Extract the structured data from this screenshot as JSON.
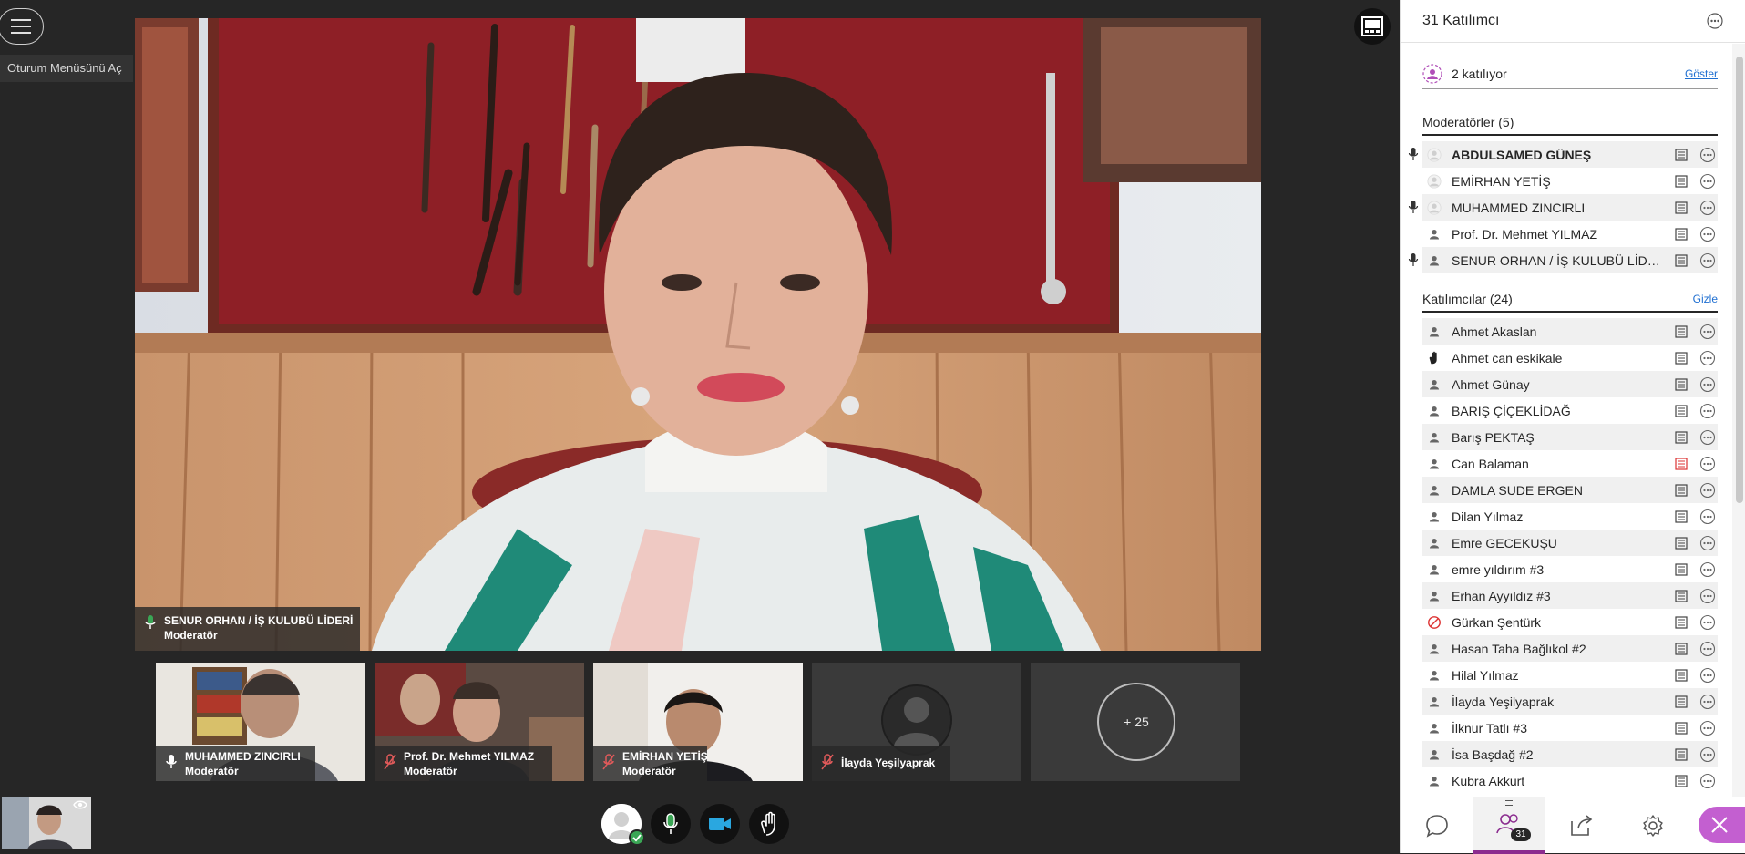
{
  "session_menu": {
    "tooltip": "Oturum Menüsünü Aç"
  },
  "main_video": {
    "name": "SENUR ORHAN / İŞ KULUBÜ LİDERİ",
    "role": "Moderatör"
  },
  "thumbnails": [
    {
      "name": "MUHAMMED ZINCIRLI",
      "role": "Moderatör",
      "mic": "on"
    },
    {
      "name": "Prof. Dr. Mehmet YILMAZ",
      "role": "Moderatör",
      "mic": "muted"
    },
    {
      "name": "EMİRHAN YETİŞ",
      "role": "Moderatör",
      "mic": "muted"
    },
    {
      "name": "İlayda Yeşilyaprak",
      "role": "",
      "mic": "muted"
    }
  ],
  "more_participants": "+ 25",
  "panel": {
    "title": "31 Katılımcı",
    "attending_text": "2 katılıyor",
    "attending_link": "Göster",
    "moderators_heading": "Moderatörler (5)",
    "moderators": [
      {
        "name": "ABDULSAMED GÜNEŞ",
        "mic": true,
        "bold": true
      },
      {
        "name": "EMİRHAN YETİŞ",
        "mic": false,
        "bold": false
      },
      {
        "name": "MUHAMMED ZINCIRLI",
        "mic": true,
        "bold": false
      },
      {
        "name": "Prof. Dr. Mehmet YILMAZ",
        "mic": false,
        "bold": false
      },
      {
        "name": "SENUR ORHAN / İŞ KULUBÜ LİDERİ",
        "mic": true,
        "bold": false
      }
    ],
    "participants_heading": "Katılımcılar (24)",
    "participants_link": "Gizle",
    "participants": [
      {
        "name": "Ahmet Akaslan",
        "avatar": "user"
      },
      {
        "name": "Ahmet can eskikale",
        "avatar": "hand"
      },
      {
        "name": "Ahmet Günay",
        "avatar": "user"
      },
      {
        "name": "BARIŞ ÇİÇEKLİDAĞ",
        "avatar": "user"
      },
      {
        "name": "Barış PEKTAŞ",
        "avatar": "user"
      },
      {
        "name": "Can Balaman",
        "avatar": "user"
      },
      {
        "name": "DAMLA SUDE ERGEN",
        "avatar": "user"
      },
      {
        "name": "Dilan Yılmaz",
        "avatar": "user"
      },
      {
        "name": "Emre GECEKUŞU",
        "avatar": "user"
      },
      {
        "name": "emre yıldırım #3",
        "avatar": "user"
      },
      {
        "name": "Erhan Ayyıldız #3",
        "avatar": "user"
      },
      {
        "name": "Gürkan Şentürk",
        "avatar": "blocked"
      },
      {
        "name": "Hasan Taha Bağlıkol #2",
        "avatar": "user"
      },
      {
        "name": "Hilal Yılmaz",
        "avatar": "user"
      },
      {
        "name": "İlayda Yeşilyaprak",
        "avatar": "user"
      },
      {
        "name": "İlknur Tatlı #3",
        "avatar": "user"
      },
      {
        "name": "İsa Başdağ #2",
        "avatar": "user"
      },
      {
        "name": "Kubra Akkurt",
        "avatar": "user"
      }
    ]
  },
  "tabs": {
    "participants_badge": "31"
  },
  "colors": {
    "accent": "#8b2c8f",
    "close_button": "#c35fd0",
    "link": "#1f6fd1",
    "mic_on": "#3aa655",
    "mic_muted": "#e05a5a",
    "stage_bg": "#262626"
  }
}
